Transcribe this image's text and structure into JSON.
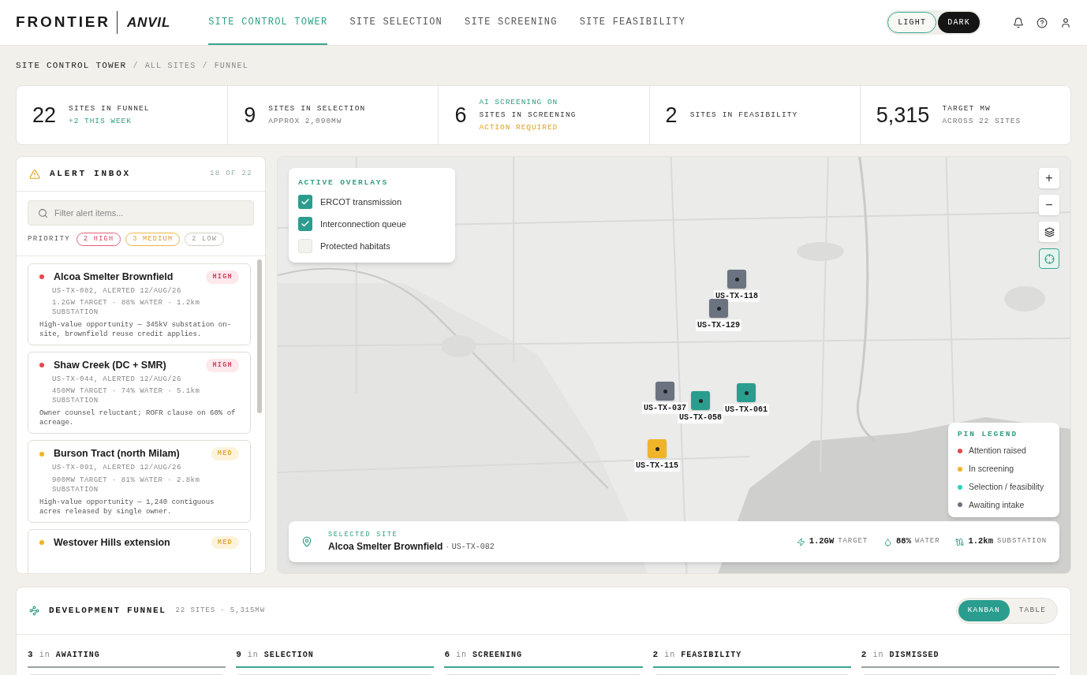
{
  "header": {
    "brand": "FRONTIER",
    "product": "ANVIL",
    "nav": [
      {
        "label": "SITE CONTROL TOWER",
        "selected": true
      },
      {
        "label": "SITE SELECTION",
        "selected": false
      },
      {
        "label": "SITE SCREENING",
        "selected": false
      },
      {
        "label": "SITE FEASIBILITY",
        "selected": false
      }
    ],
    "theme": [
      {
        "label": "LIGHT",
        "selected": false
      },
      {
        "label": "DARK",
        "selected": true
      }
    ]
  },
  "breadcrumb": {
    "separator": "/",
    "items": [
      "SITE CONTROL TOWER",
      "ALL SITES",
      "FUNNEL"
    ]
  },
  "stats": [
    {
      "value": "22",
      "lines": [
        {
          "text": "SITES IN FUNNEL",
          "kind": "label"
        },
        {
          "text": "+2 THIS WEEK",
          "kind": "good"
        }
      ]
    },
    {
      "value": "9",
      "lines": [
        {
          "text": "SITES IN SELECTION",
          "kind": "label"
        },
        {
          "text": "APPROX 2,090MW",
          "kind": "muted"
        }
      ]
    },
    {
      "value": "6",
      "lines": [
        {
          "text": "AI SCREENING ON",
          "kind": "good"
        },
        {
          "text": "SITES IN SCREENING",
          "kind": "label"
        },
        {
          "text": "ACTION REQUIRED",
          "kind": "warn"
        }
      ]
    },
    {
      "value": "2",
      "lines": [
        {
          "text": "SITES IN FEASIBILITY",
          "kind": "label"
        }
      ]
    },
    {
      "value": "5,315",
      "lines": [
        {
          "text": "TARGET MW",
          "kind": "label"
        },
        {
          "text": "ACROSS 22 SITES",
          "kind": "muted"
        }
      ]
    }
  ],
  "alert_inbox": {
    "title": "ALERT INBOX",
    "count": "18 OF 22",
    "search": {
      "placeholder": "Filter alert items..."
    },
    "priority_label": "PRIORITY",
    "filters": [
      {
        "label": "2 HIGH",
        "kind": "high"
      },
      {
        "label": "3 MEDIUM",
        "kind": "medium"
      },
      {
        "label": "2 LOW",
        "kind": "low"
      }
    ],
    "alerts": [
      {
        "name": "Alcoa Smelter Brownfield",
        "badge": "HIGH",
        "kind": "high",
        "id_line": "US-TX-082, ALERTED 12/AUG/26",
        "metrics": "1.2GW TARGET · 88% WATER · 1.2km SUBSTATION",
        "note": "High-value opportunity — 345kV substation on-site, brownfield reuse credit applies."
      },
      {
        "name": "Shaw Creek (DC + SMR)",
        "badge": "HIGH",
        "kind": "high",
        "id_line": "US-TX-044, ALERTED 12/AUG/26",
        "metrics": "450MW TARGET · 74% WATER · 5.1km SUBSTATION",
        "note": "Owner counsel reluctant; ROFR clause on 60% of acreage."
      },
      {
        "name": "Burson Tract (north Milam)",
        "badge": "MED",
        "kind": "medium",
        "id_line": "US-TX-091, ALERTED 12/AUG/26",
        "metrics": "900MW TARGET · 81% WATER · 2.8km SUBSTATION",
        "note": "High-value opportunity — 1,240 contiguous acres released by single owner."
      },
      {
        "name": "Westover Hills extension",
        "badge": "MED",
        "kind": "medium"
      }
    ]
  },
  "map": {
    "overlays": {
      "title": "ACTIVE OVERLAYS",
      "items": [
        {
          "label": "ERCOT transmission",
          "checked": true
        },
        {
          "label": "Interconnection queue",
          "checked": true
        },
        {
          "label": "Protected habitats",
          "checked": false
        }
      ]
    },
    "controls": [
      "+",
      "−"
    ],
    "pins": [
      {
        "label": "US-TX-118",
        "kind": "awaiting"
      },
      {
        "label": "US-TX-129",
        "kind": "awaiting"
      },
      {
        "label": "US-TX-037",
        "kind": "awaiting"
      },
      {
        "label": "US-TX-058",
        "kind": "selection"
      },
      {
        "label": "US-TX-061",
        "kind": "selection"
      },
      {
        "label": "US-TX-115",
        "kind": "screening"
      }
    ],
    "legend": {
      "title": "PIN LEGEND",
      "items": [
        {
          "label": "Attention raised",
          "color": "#e5484d"
        },
        {
          "label": "In screening",
          "color": "#f0b429"
        },
        {
          "label": "Selection / feasibility",
          "color": "#2dd4bf"
        },
        {
          "label": "Awaiting intake",
          "color": "#6b7280"
        }
      ]
    },
    "selected_site": {
      "caption": "SELECTED SITE",
      "name": "Alcoa Smelter Brownfield",
      "separator": "·",
      "code": "US-TX-082",
      "metrics": [
        {
          "kind": "power",
          "value": "1.2GW",
          "unit": "TARGET"
        },
        {
          "kind": "water",
          "value": "88%",
          "unit": "WATER"
        },
        {
          "kind": "grid",
          "value": "1.2km",
          "unit": "SUBSTATION"
        }
      ]
    }
  },
  "funnel": {
    "title": "DEVELOPMENT FUNNEL",
    "summary": "22 SITES · 5,315MW",
    "views": [
      {
        "label": "KANBAN",
        "selected": true
      },
      {
        "label": "TABLE",
        "selected": false
      }
    ],
    "columns": [
      {
        "count": "3",
        "word": "in",
        "label": "AWAITING",
        "color": "#9ca3a0"
      },
      {
        "count": "9",
        "word": "in",
        "label": "SELECTION",
        "color": "#3aa58f"
      },
      {
        "count": "6",
        "word": "in",
        "label": "SCREENING",
        "color": "#3aa58f"
      },
      {
        "count": "2",
        "word": "in",
        "label": "FEASIBILITY",
        "color": "#3aa58f"
      },
      {
        "count": "2",
        "word": "in",
        "label": "DISMISSED",
        "color": "#9ca3a0"
      }
    ]
  }
}
